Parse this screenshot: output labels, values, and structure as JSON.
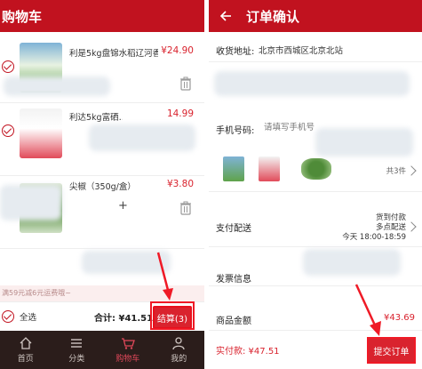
{
  "cart": {
    "title": "购物车",
    "items": [
      {
        "name": "利是5kg盘锦水稻辽河香",
        "price": "¥24.90"
      },
      {
        "name": "利达5kg富硒…",
        "price": "14.99"
      },
      {
        "name": "尖椒（350g/盒）",
        "price": "¥3.80"
      }
    ],
    "promo": "满59元减6元运费哦~",
    "select_all": "全选",
    "total": "合计: ¥41.51",
    "checkout": "结算(3)"
  },
  "tabs": [
    {
      "label": "首页",
      "icon": "home-icon"
    },
    {
      "label": "分类",
      "icon": "menu-icon"
    },
    {
      "label": "购物车",
      "icon": "cart-icon"
    },
    {
      "label": "我的",
      "icon": "user-icon"
    }
  ],
  "order": {
    "title": "订单确认",
    "address_label": "收货地址:",
    "address_value": "北京市西城区北京北站",
    "phone_label": "手机号码:",
    "phone_placeholder": "请填写手机号",
    "item_count": "共3件",
    "delivery_label": "支付配送",
    "pay_method": "货到付款",
    "delivery_method": "多点配送",
    "delivery_time": "今天 18:00-18:59",
    "invoice_label": "发票信息",
    "goods_amount_label": "商品金额",
    "goods_amount": "¥43.69",
    "actual_pay": "实付款: ¥47.51",
    "submit": "提交订单"
  },
  "colors": {
    "brand_red": "#c1121f",
    "price_red": "#d9232e",
    "tabbar_bg": "#2b1d1b"
  }
}
